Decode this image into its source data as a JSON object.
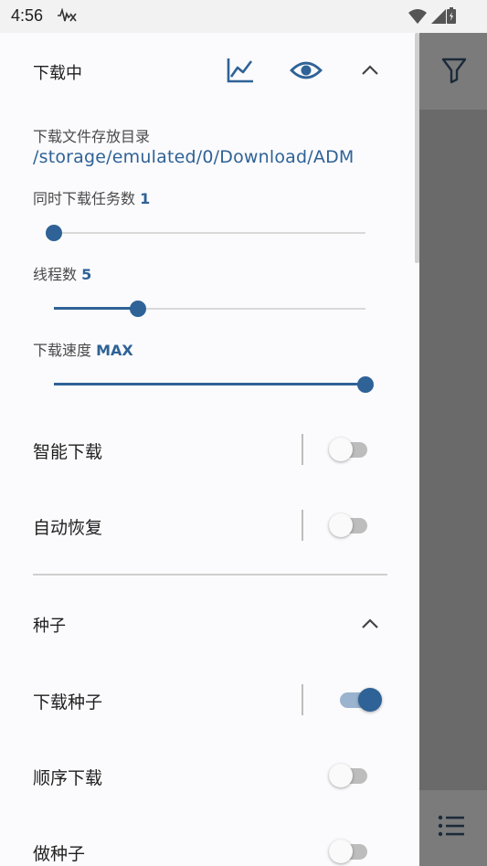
{
  "status_bar": {
    "time": "4:56"
  },
  "drawer": {
    "download_section": {
      "title": "下载中",
      "dir_label": "下载文件存放目录",
      "dir_path": "/storage/emulated/0/Download/ADM",
      "concurrent": {
        "label": "同时下载任务数",
        "value": "1",
        "fraction": 0.0
      },
      "threads": {
        "label": "线程数",
        "value": "5",
        "fraction": 0.27
      },
      "speed": {
        "label": "下载速度",
        "value": "MAX",
        "fraction": 1.0
      },
      "smart_download": {
        "label": "智能下载",
        "on": false
      },
      "auto_resume": {
        "label": "自动恢复",
        "on": false
      }
    },
    "torrent_section": {
      "title": "种子",
      "download_torrent": {
        "label": "下载种子",
        "on": true
      },
      "sequential": {
        "label": "顺序下载",
        "on": false
      },
      "seeding": {
        "label": "做种子",
        "on": false
      }
    }
  },
  "colors": {
    "accent": "#2f6296",
    "scrim": "#6e6e6e"
  }
}
